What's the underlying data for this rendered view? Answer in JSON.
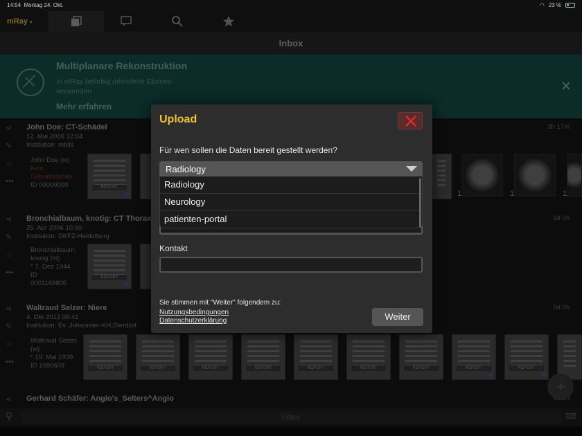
{
  "status": {
    "time": "14:54",
    "date": "Montag 24. Okt.",
    "battery": "23 %"
  },
  "tabbar": {
    "logo": "mRay"
  },
  "header": {
    "title": "Inbox"
  },
  "promo": {
    "title": "Multiplanare Rekonstruktion",
    "description": "In mRay beliebig orientierte Ebenen verwenden",
    "more": "Mehr erfahren",
    "close": "×"
  },
  "studies": [
    {
      "name": "John Doe: CT-Schädel",
      "date": "12. Mai 2016 12:04",
      "institution": "Institution: mbits",
      "ago": "3h 17m",
      "patient_name": "John Doe (w)",
      "patient_birth": "Kein Geburtsdatum",
      "patient_id": "ID 00000000"
    },
    {
      "name": "Bronchialbaum, knotig: CT Thorax",
      "date": "25. Apr 2006 10:50",
      "institution": "Institution: DKFZ-Heidelberg",
      "ago": "3d 0h",
      "patient_name": "Bronchialbaum, knotig (m)",
      "patient_birth": "* 7. Dez 1944",
      "patient_id": "ID 0001169805"
    },
    {
      "name": "Waltraud Selzer: Niere",
      "date": "4. Okt 2012 08:41",
      "institution": "Institution: Ev. Johanniter-KH,Dierdorf",
      "ago": "5d 0h",
      "patient_name": "Waltraud Selzer (w)",
      "patient_birth": "* 19. Mai 1939",
      "patient_id": "ID 1080609"
    },
    {
      "name": "Gerhard Schäfer: Angio's_Selters^Angio",
      "ago": "5d 0h"
    }
  ],
  "thumb_label": "REPORT",
  "xray_count": "1",
  "filter": {
    "placeholder": "Filter"
  },
  "dialog": {
    "title": "Upload",
    "question": "Für wen sollen die Daten bereit gestellt werden?",
    "selected": "Radiology",
    "options": [
      "Radiology",
      "Neurology",
      "patienten-portal"
    ],
    "contact_label": "Kontakt",
    "contact_value": "",
    "agree_text": "Sie stimmen mit \"Weiter\" folgendem zu:",
    "terms_link": "Nutzungsbedingungen",
    "privacy_link": "Datenschutzerklärung",
    "continue_button": "Weiter"
  },
  "colors": {
    "accent": "#f2c230",
    "close_red": "#e02a2a",
    "promo_bg": "#0f3b37"
  }
}
